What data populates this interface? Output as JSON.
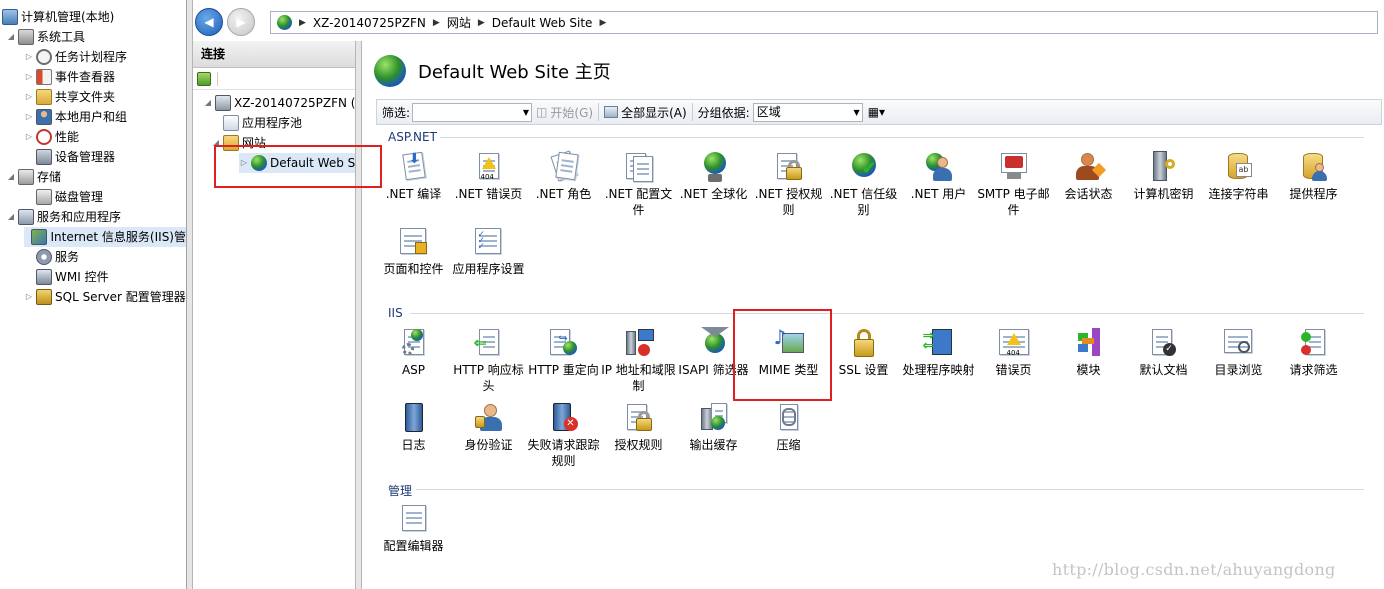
{
  "left_tree": {
    "items": [
      {
        "label": "计算机管理(本地)",
        "icon": "computer-management-icon",
        "twisty": ""
      },
      {
        "label": "系统工具",
        "icon": "tools-icon",
        "twisty": "◢"
      },
      {
        "label": "任务计划程序",
        "icon": "clock-icon",
        "twisty": "▷"
      },
      {
        "label": "事件查看器",
        "icon": "event-viewer-icon",
        "twisty": "▷"
      },
      {
        "label": "共享文件夹",
        "icon": "shared-folder-icon",
        "twisty": "▷"
      },
      {
        "label": "本地用户和组",
        "icon": "users-icon",
        "twisty": "▷"
      },
      {
        "label": "性能",
        "icon": "performance-icon",
        "twisty": "▷"
      },
      {
        "label": "设备管理器",
        "icon": "device-manager-icon",
        "twisty": ""
      },
      {
        "label": "存储",
        "icon": "storage-icon",
        "twisty": "◢"
      },
      {
        "label": "磁盘管理",
        "icon": "disk-icon",
        "twisty": ""
      },
      {
        "label": "服务和应用程序",
        "icon": "services-apps-icon",
        "twisty": "◢"
      },
      {
        "label": "Internet 信息服务(IIS)管",
        "icon": "iis-icon",
        "twisty": ""
      },
      {
        "label": "服务",
        "icon": "services-icon",
        "twisty": ""
      },
      {
        "label": "WMI 控件",
        "icon": "wmi-icon",
        "twisty": ""
      },
      {
        "label": "SQL Server 配置管理器",
        "icon": "sql-server-icon",
        "twisty": "▷"
      }
    ]
  },
  "nav": {
    "back": "◀",
    "forward": "▶",
    "breadcrumb": [
      "XZ-20140725PZFN",
      "网站",
      "Default Web Site"
    ],
    "sep": "▶"
  },
  "connections": {
    "header": "连接",
    "tree": [
      {
        "label": "XZ-20140725PZFN (X",
        "icon": "server-icon",
        "twisty": "◢"
      },
      {
        "label": "应用程序池",
        "icon": "app-pool-icon",
        "twisty": ""
      },
      {
        "label": "网站",
        "icon": "sites-folder-icon",
        "twisty": "◢"
      },
      {
        "label": "Default Web S",
        "icon": "website-globe-icon",
        "twisty": "▷"
      }
    ]
  },
  "main": {
    "title": "Default Web Site 主页",
    "filter": {
      "label": "筛选:",
      "value": "",
      "start": "开始(G)",
      "show_all": "全部显示(A)",
      "group_by_label": "分组依据:",
      "group_by_value": "区域"
    },
    "sections": [
      {
        "name": "ASP.NET",
        "features": [
          ".NET 编译",
          ".NET 错误页",
          ".NET 角色",
          ".NET 配置文件",
          ".NET 全球化",
          ".NET 授权规则",
          ".NET 信任级别",
          ".NET 用户",
          "SMTP 电子邮件",
          "会话状态",
          "计算机密钥",
          "连接字符串",
          "提供程序",
          "页面和控件",
          "应用程序设置"
        ]
      },
      {
        "name": "IIS",
        "features": [
          "ASP",
          "HTTP 响应标头",
          "HTTP 重定向",
          "IP 地址和域限制",
          "ISAPI 筛选器",
          "MIME 类型",
          "SSL 设置",
          "处理程序映射",
          "错误页",
          "模块",
          "默认文档",
          "目录浏览",
          "请求筛选",
          "日志",
          "身份验证",
          "失败请求跟踪规则",
          "授权规则",
          "输出缓存",
          "压缩"
        ]
      },
      {
        "name": "管理",
        "features": [
          "配置编辑器"
        ]
      }
    ]
  },
  "watermark": "http://blog.csdn.net/ahuyangdong",
  "colors": {
    "highlight_box": "#e02020",
    "section_text": "#1e3a74",
    "selected_row": "#dbe8f7"
  }
}
